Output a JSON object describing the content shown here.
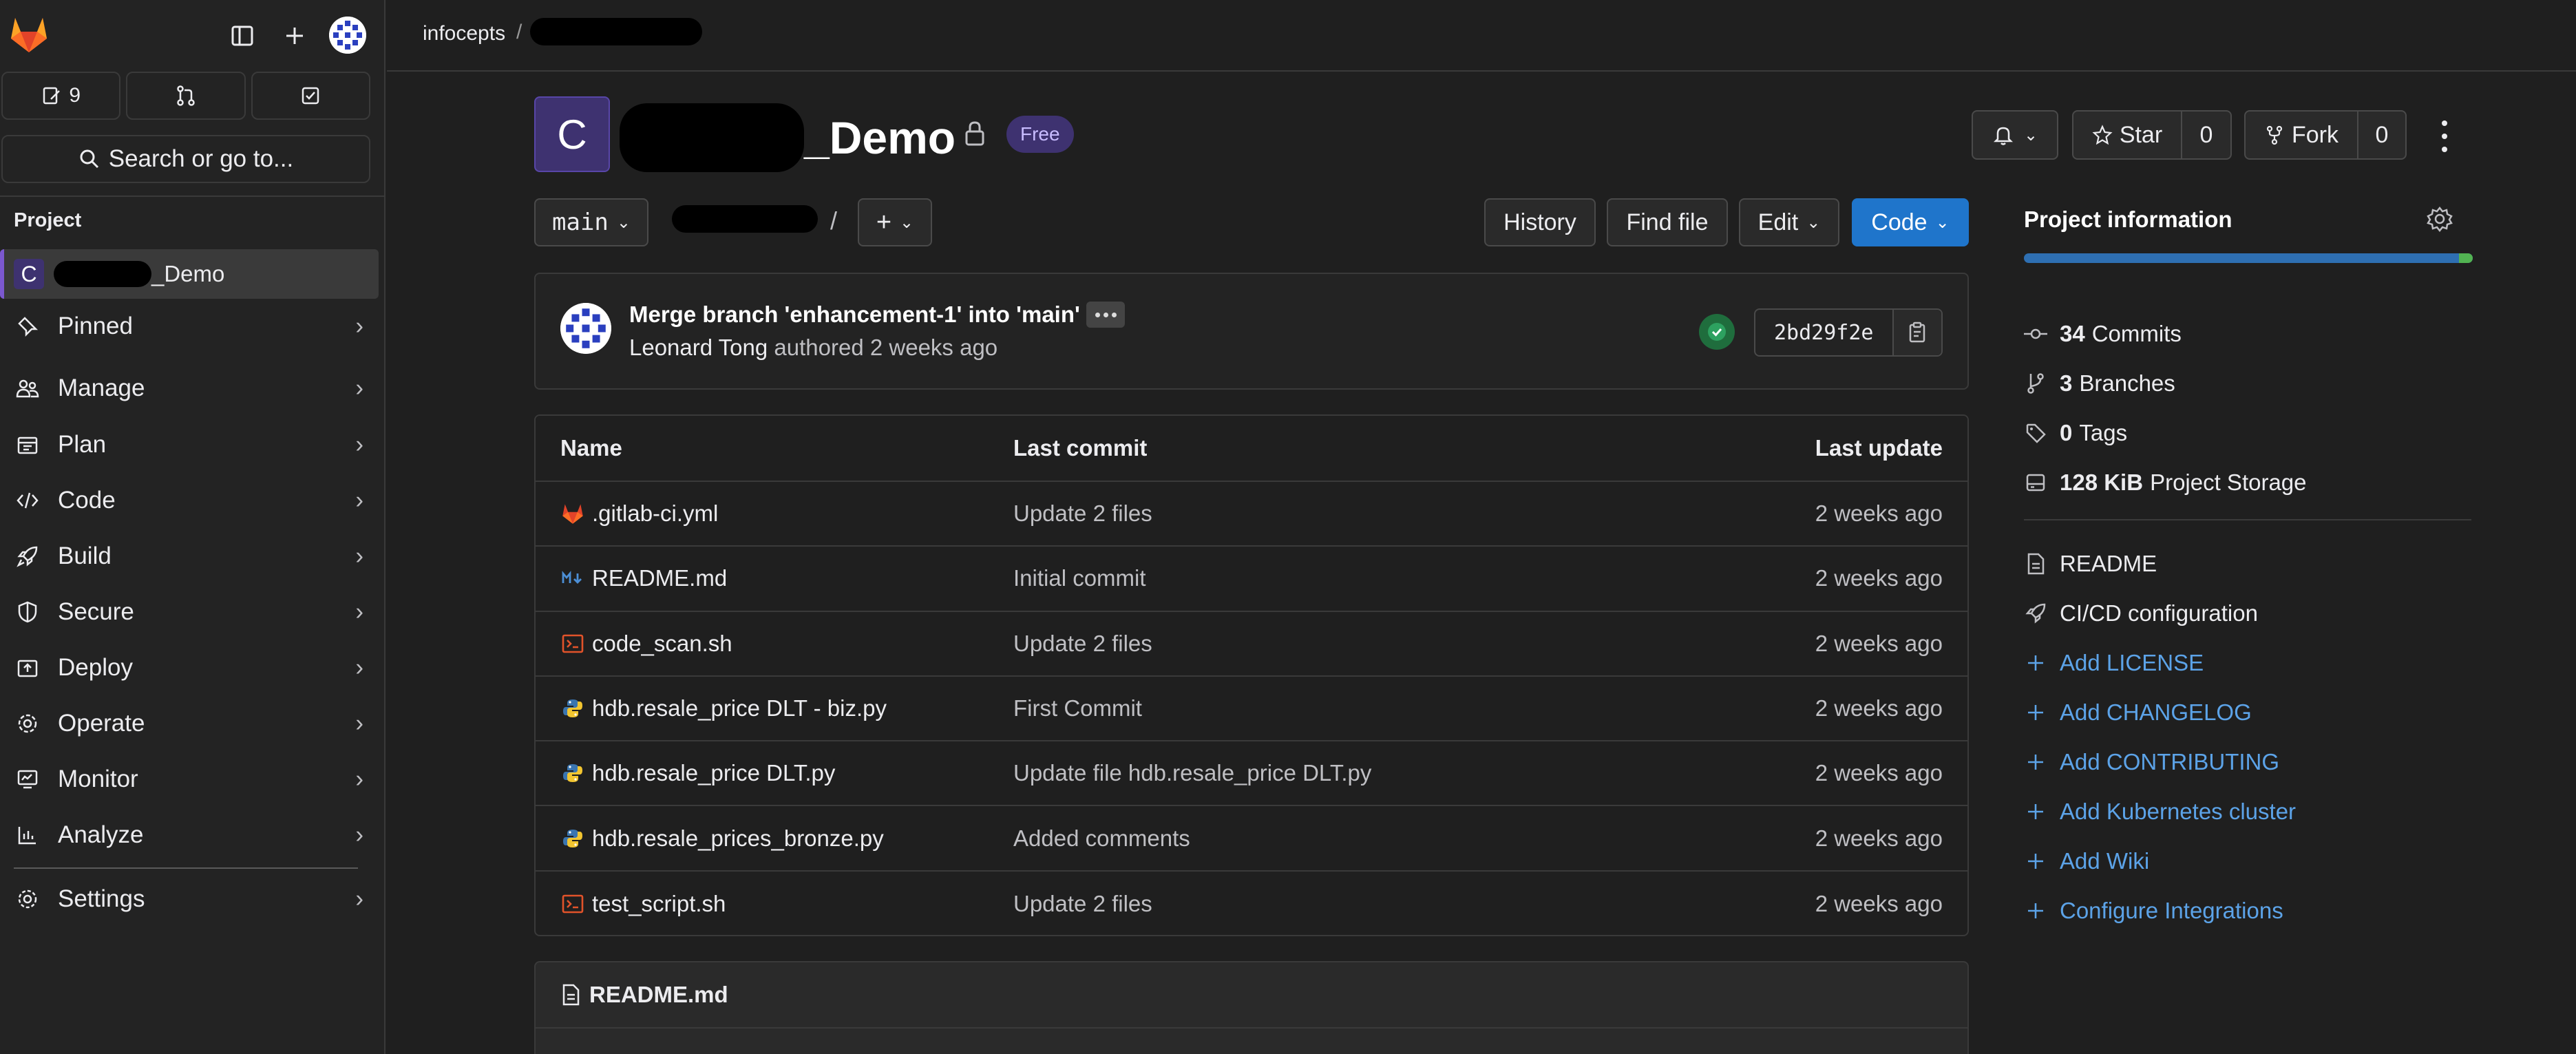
{
  "sidebar": {
    "issue_count": "9",
    "search_label": "Search or go to...",
    "section_heading": "Project",
    "current_project_initial": "C",
    "current_project_suffix": "_Demo",
    "nav": [
      {
        "label": "Pinned",
        "icon": "pin-icon"
      },
      {
        "label": "Manage",
        "icon": "users-icon"
      },
      {
        "label": "Plan",
        "icon": "calendar-icon"
      },
      {
        "label": "Code",
        "icon": "code-icon"
      },
      {
        "label": "Build",
        "icon": "rocket-icon"
      },
      {
        "label": "Secure",
        "icon": "shield-icon"
      },
      {
        "label": "Deploy",
        "icon": "deploy-icon"
      },
      {
        "label": "Operate",
        "icon": "cloud-gear-icon"
      },
      {
        "label": "Monitor",
        "icon": "monitor-icon"
      },
      {
        "label": "Analyze",
        "icon": "chart-icon"
      }
    ],
    "settings_label": "Settings"
  },
  "topbar": {
    "breadcrumb_group": "infocepts",
    "breadcrumb_sep": "/",
    "breadcrumb_project_suffix": "_"
  },
  "project": {
    "initial": "C",
    "title_suffix": "_Demo",
    "badge": "Free",
    "star_label": "Star",
    "star_count": "0",
    "fork_label": "Fork",
    "fork_count": "0"
  },
  "toolbar": {
    "branch": "main",
    "path_sep": "/",
    "history_label": "History",
    "find_file_label": "Find file",
    "edit_label": "Edit",
    "code_label": "Code"
  },
  "commit": {
    "title": "Merge branch 'enhancement-1' into 'main'",
    "author": "Leonard Tong",
    "meta": "authored 2 weeks ago",
    "sha": "2bd29f2e"
  },
  "files": {
    "headers": {
      "name": "Name",
      "last_commit": "Last commit",
      "last_update": "Last update"
    },
    "rows": [
      {
        "name": ".gitlab-ci.yml",
        "icon": "gitlab-icon",
        "commit": "Update 2 files",
        "updated": "2 weeks ago"
      },
      {
        "name": "README.md",
        "icon": "markdown-icon",
        "commit": "Initial commit",
        "updated": "2 weeks ago"
      },
      {
        "name": "code_scan.sh",
        "icon": "terminal-icon",
        "commit": "Update 2 files",
        "updated": "2 weeks ago"
      },
      {
        "name": "hdb.resale_price DLT - biz.py",
        "icon": "python-icon",
        "commit": "First Commit",
        "updated": "2 weeks ago"
      },
      {
        "name": "hdb.resale_price DLT.py",
        "icon": "python-icon",
        "commit": "Update file hdb.resale_price DLT.py",
        "updated": "2 weeks ago"
      },
      {
        "name": "hdb.resale_prices_bronze.py",
        "icon": "python-icon",
        "commit": "Added comments",
        "updated": "2 weeks ago"
      },
      {
        "name": "test_script.sh",
        "icon": "terminal-icon",
        "commit": "Update 2 files",
        "updated": "2 weeks ago"
      }
    ]
  },
  "readme": {
    "title": "README.md"
  },
  "info": {
    "title": "Project information",
    "usage_fraction": 0.97,
    "commits_count": "34",
    "commits_label": "Commits",
    "branches_count": "3",
    "branches_label": "Branches",
    "tags_count": "0",
    "tags_label": "Tags",
    "storage_size": "128 KiB",
    "storage_label": "Project Storage",
    "links_white": [
      "README",
      "CI/CD configuration"
    ],
    "links_blue": [
      "Add LICENSE",
      "Add CHANGELOG",
      "Add CONTRIBUTING",
      "Add Kubernetes cluster",
      "Add Wiki",
      "Configure Integrations"
    ]
  },
  "colors": {
    "accent_blue": "#1f75cb",
    "link_blue": "#5ca3e8",
    "project_purple": "#3e3270",
    "success_green": "#52b352"
  }
}
